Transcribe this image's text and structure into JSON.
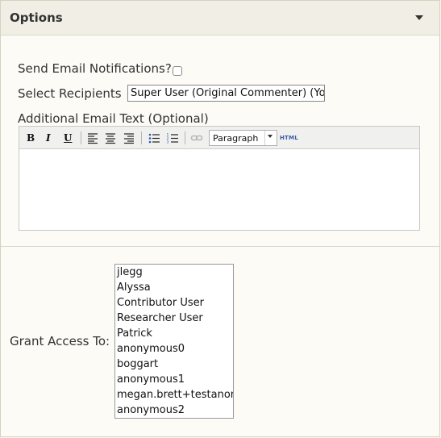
{
  "panel": {
    "title": "Options"
  },
  "notifications": {
    "label": "Send Email Notifications?",
    "checked": false
  },
  "recipients": {
    "label": "Select Recipients",
    "value": "Super User (Original Commenter) (You)"
  },
  "email_text": {
    "label": "Additional Email Text (Optional)",
    "toolbar": {
      "bold": "B",
      "italic": "I",
      "underline": "U",
      "format_value": "Paragraph",
      "html_label": "HTML"
    },
    "body": ""
  },
  "grant_access": {
    "label": "Grant Access To:",
    "users": [
      "jlegg",
      "Alyssa",
      "Contributor User",
      "Researcher User",
      "Patrick",
      "anonymous0",
      "boggart",
      "anonymous1",
      "megan.brett+testanon",
      "anonymous2"
    ]
  },
  "icons": {
    "collapse": "caret-down-icon",
    "align_left": "align-left-icon",
    "align_center": "align-center-icon",
    "align_right": "align-right-icon",
    "bullet_list": "bullet-list-icon",
    "numbered_list": "numbered-list-icon",
    "link": "link-icon"
  }
}
